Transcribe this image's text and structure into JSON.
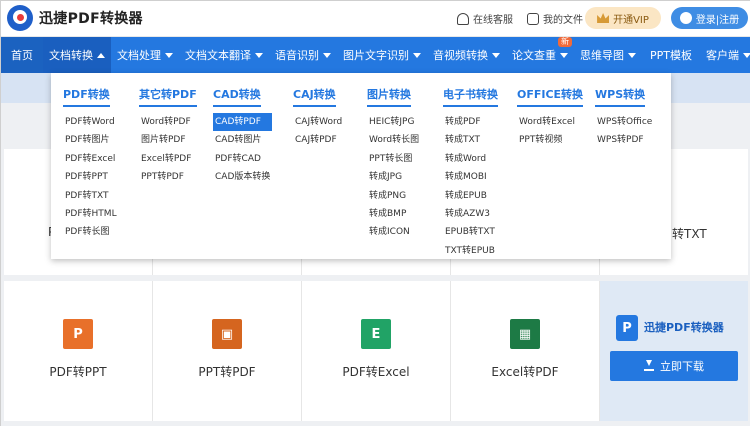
{
  "header": {
    "logo_text": "迅捷PDF转换器",
    "links": [
      {
        "label": "在线客服",
        "icon": "headset-icon"
      },
      {
        "label": "我的文件",
        "icon": "file-icon"
      }
    ],
    "vip_label": "开通VIP",
    "login_label": "登录|注册"
  },
  "nav": {
    "items": [
      {
        "label": "首页"
      },
      {
        "label": "文档转换"
      },
      {
        "label": "文档处理"
      },
      {
        "label": "文档文本翻译"
      },
      {
        "label": "语音识别"
      },
      {
        "label": "图片文字识别"
      },
      {
        "label": "音视频转换"
      },
      {
        "label": "论文查重",
        "badge": "新"
      },
      {
        "label": "思维导图"
      },
      {
        "label": "PPT模板"
      },
      {
        "label": "客户端"
      }
    ]
  },
  "dropdown": {
    "columns": [
      {
        "title": "PDF转换",
        "items": [
          "PDF转Word",
          "PDF转图片",
          "PDF转Excel",
          "PDF转PPT",
          "PDF转TXT",
          "PDF转HTML",
          "PDF转长图"
        ]
      },
      {
        "title": "其它转PDF",
        "items": [
          "Word转PDF",
          "图片转PDF",
          "Excel转PDF",
          "PPT转PDF"
        ]
      },
      {
        "title": "CAD转换",
        "items": [
          "CAD转PDF",
          "CAD转图片",
          "PDF转CAD",
          "CAD版本转换"
        ],
        "selected": 0
      },
      {
        "title": "CAJ转换",
        "items": [
          "CAJ转Word",
          "CAJ转PDF"
        ]
      },
      {
        "title": "图片转换",
        "items": [
          "HEIC转JPG",
          "Word转长图",
          "PPT转长图",
          "转成JPG",
          "转成PNG",
          "转成BMP",
          "转成ICON"
        ]
      },
      {
        "title": "电子书转换",
        "items": [
          "转成PDF",
          "转成TXT",
          "转成Word",
          "转成MOBI",
          "转成EPUB",
          "转成AZW3",
          "EPUB转TXT",
          "TXT转EPUB"
        ]
      },
      {
        "title": "OFFICE转换",
        "items": [
          "Word转Excel",
          "PPT转视频"
        ]
      },
      {
        "title": "WPS转换",
        "items": [
          "WPS转Office",
          "WPS转PDF"
        ]
      }
    ]
  },
  "background": {
    "row1_partial": [
      "P",
      "转TXT"
    ],
    "cards": [
      {
        "label": "PDF转PPT",
        "tile": "P",
        "color": "#e8702a"
      },
      {
        "label": "PPT转PDF",
        "tile": "▣",
        "color": "#d5651f"
      },
      {
        "label": "PDF转Excel",
        "tile": "E",
        "color": "#21a366"
      },
      {
        "label": "Excel转PDF",
        "tile": "▦",
        "color": "#1d7a45"
      }
    ],
    "promo": {
      "mark": "P",
      "name": "迅捷PDF转换器",
      "download_label": "立即下载"
    }
  },
  "colors": {
    "primary": "#2478e0",
    "nav_active": "#1a5fbf",
    "vip_bg": "#fbe6c4"
  }
}
